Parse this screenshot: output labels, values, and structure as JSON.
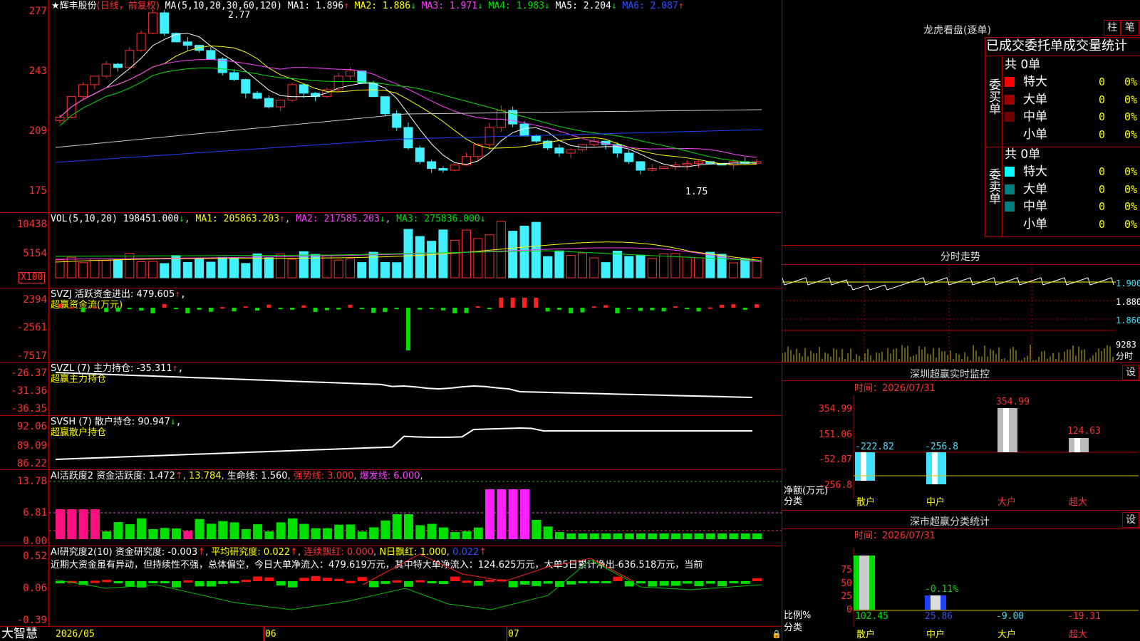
{
  "main": {
    "title_star": "★",
    "stock_name": "辉丰股份",
    "period": "(日线，前复权)",
    "ma_header": "MA(5,10,20,30,60,120)",
    "ma1": "MA1: 1.896",
    "ma2": "MA2: 1.886",
    "ma3": "MA3: 1.971",
    "ma4": "MA4: 1.983",
    "ma5": "MA5: 2.204",
    "ma6": "MA6: 2.087",
    "arrow_up": "↑",
    "arrow_down": "↓",
    "high_label": "2.77",
    "low_label": "1.75",
    "y_ticks": [
      "277",
      "243",
      "209",
      "175"
    ]
  },
  "vol": {
    "header": "VOL(5,10,20)",
    "value": "198451.000",
    "ma1": "MA1: 205863.203",
    "ma2": "MA2: 217585.203",
    "ma3": "MA3: 275836.000",
    "y_ticks": [
      "10438",
      "5154"
    ],
    "unit": "X100"
  },
  "svzj": {
    "header": "SVZJ  活跃资金进出: 479.605",
    "sub": "超赢资金流(万元)",
    "y_ticks": [
      "2394",
      "-2561",
      "-7517"
    ]
  },
  "svzl": {
    "header": "SVZL (7) 主力持仓: -35.311",
    "sub": "超赢主力持仓",
    "y_ticks": [
      "-26.37",
      "-31.36",
      "-36.35"
    ]
  },
  "svsh": {
    "header": "SVSH (7) 散户持仓: 90.947",
    "sub": "超赢散户持仓",
    "y_ticks": [
      "92.06",
      "89.09",
      "86.22"
    ]
  },
  "ai1": {
    "header": "AI活跃度2 资金活跃度: 1.472",
    "v2": "13.784",
    "v3": "生命线: 1.560",
    "v4": "强势线: 3.000",
    "v5": "爆发线: 6.000",
    "y_ticks": [
      "13.78",
      "6.81",
      "0.00"
    ]
  },
  "ai2": {
    "header": "AI研究度2(10) 资金研究度: -0.003",
    "v2": "平均研究度: 0.022",
    "v3": "连续飘红: 0.000",
    "v4": "N日飘红: 1.000",
    "v5": "0.022",
    "comment": "近期大资金虽有异动，但持续性不强，总体偏空，今日大单净流入：479.619万元，其中特大单净流入：124.625万元，大单5日累计净出-636.518万元，当前",
    "y_ticks": [
      "0.52",
      "0.06",
      "-0.39"
    ]
  },
  "bottom": {
    "brand": "大智慧",
    "dates": [
      "2026/05",
      "06",
      "07"
    ]
  },
  "dragon": {
    "title": "龙虎看盘(逐单)",
    "btn1": "柱",
    "btn2": "笔",
    "subtitle": "已成交委托单成交量统计",
    "buy_label": "委买单",
    "sell_label": "委卖单",
    "buy_total": "共 0单",
    "sell_total": "共 0单",
    "buy_rows": [
      {
        "name": "特大",
        "count": "0",
        "pct": "0%",
        "color": "#ff0000"
      },
      {
        "name": "大单",
        "count": "0",
        "pct": "0%",
        "color": "#a00000"
      },
      {
        "name": "中单",
        "count": "0",
        "pct": "0%",
        "color": "#700000"
      },
      {
        "name": "小单",
        "count": "0",
        "pct": "0%",
        "color": ""
      }
    ],
    "sell_rows": [
      {
        "name": "特大",
        "count": "0",
        "pct": "0%",
        "color": "#00ffff"
      },
      {
        "name": "大单",
        "count": "0",
        "pct": "0%",
        "color": "#008080"
      },
      {
        "name": "中单",
        "count": "0",
        "pct": "0%",
        "color": "#008080"
      },
      {
        "name": "小单",
        "count": "0",
        "pct": "0%",
        "color": ""
      }
    ]
  },
  "intraday": {
    "title": "分时走势",
    "y_ticks": [
      "1.900",
      "1.880",
      "1.860"
    ],
    "vol_tick": "9283",
    "unit": "分时"
  },
  "monitor": {
    "title": "深圳超赢实时监控",
    "settings": "设",
    "time": "时间：2026/07/31",
    "y_ticks": [
      "354.99",
      "151.06",
      "-52.87",
      "-256.8"
    ],
    "y_label": "净额(万元)",
    "x_label": "分类",
    "categories": [
      "散户",
      "中户",
      "大户",
      "超大"
    ],
    "values": [
      "-222.82",
      "-256.8",
      "354.99",
      "124.63"
    ]
  },
  "stats": {
    "title": "深市超赢分类统计",
    "settings": "设",
    "time": "时间：2026/07/31",
    "y_ticks": [
      "75",
      "50",
      "25",
      "0"
    ],
    "y_label": "比例%",
    "x_label": "分类",
    "categories": [
      "散户",
      "中户",
      "大户",
      "超大"
    ],
    "values": [
      "102.45",
      "25.86",
      "-9.00",
      "-19.31"
    ],
    "mid_label": "-0.11%"
  }
}
